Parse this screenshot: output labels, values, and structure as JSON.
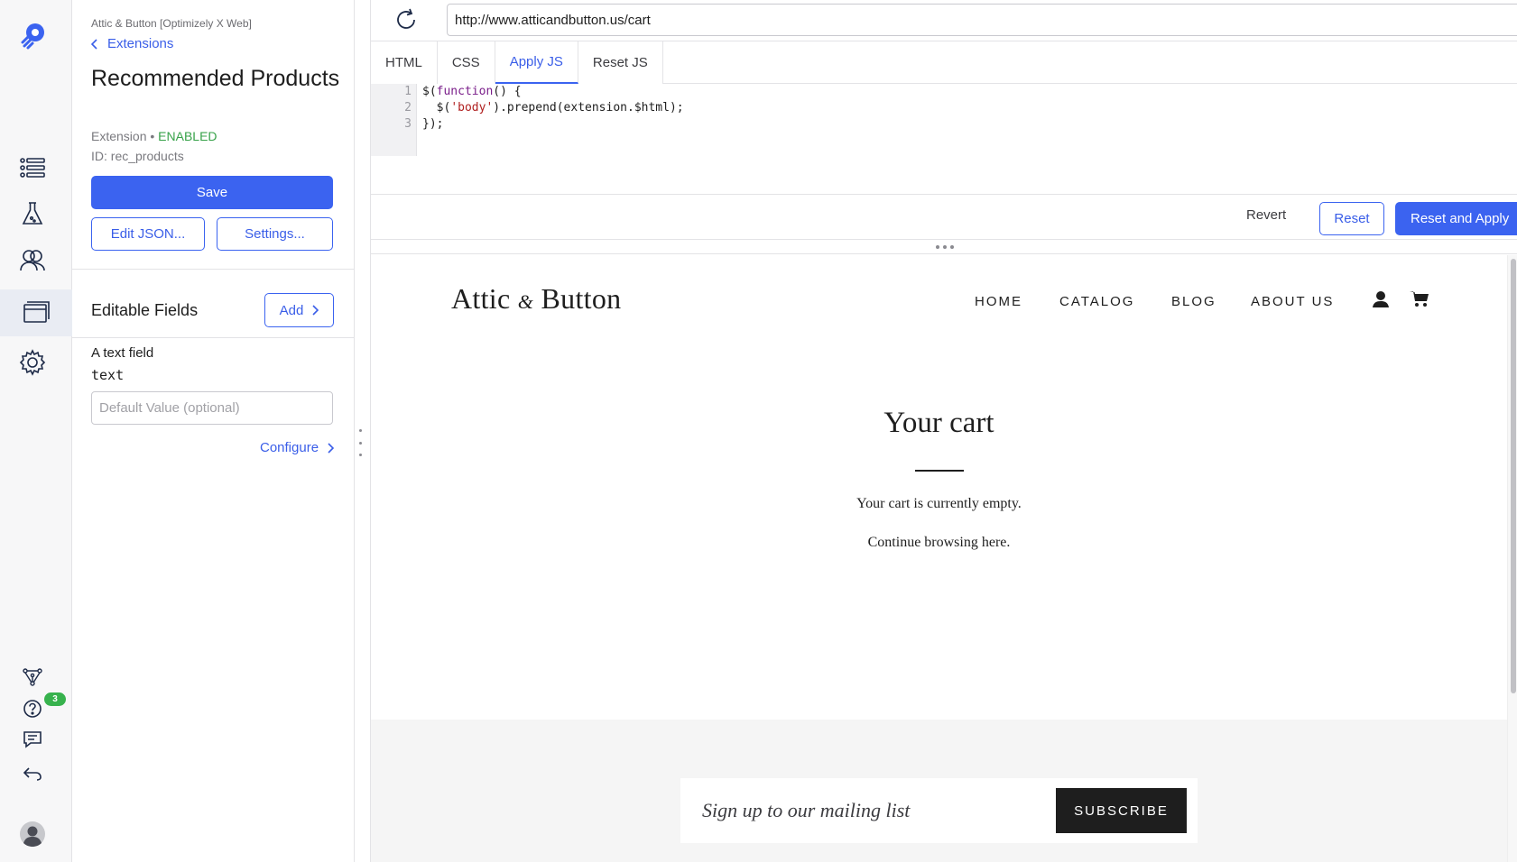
{
  "sidebar": {
    "project_name": "Attic & Button [Optimizely X Web]",
    "back_label": "Extensions",
    "title": "Recommended Products",
    "type_label": "Extension",
    "separator": " • ",
    "status": "ENABLED",
    "id_label": "ID: rec_products",
    "save_label": "Save",
    "edit_json_label": "Edit JSON...",
    "settings_label": "Settings...",
    "editable_fields_title": "Editable Fields",
    "add_label": "Add",
    "field": {
      "label": "A text field",
      "type": "text",
      "placeholder": "Default Value (optional)",
      "configure_label": "Configure"
    }
  },
  "rail": {
    "icons": [
      "logo-icon",
      "list-icon",
      "flask-icon",
      "audiences-icon",
      "extensions-icon",
      "gear-icon",
      "graph-icon",
      "help-icon",
      "chat-icon",
      "return-icon",
      "avatar-icon"
    ],
    "help_badge": "3"
  },
  "editor": {
    "url": "http://www.atticandbutton.us/cart",
    "tabs": [
      "HTML",
      "CSS",
      "Apply JS",
      "Reset JS"
    ],
    "active_tab": "Apply JS",
    "line_numbers": [
      "1",
      "2",
      "3"
    ],
    "code": {
      "line1_a": "$(",
      "line1_kw": "function",
      "line1_b": "() {",
      "line2_a": "  $(",
      "line2_str": "'body'",
      "line2_b": ").prepend(extension.$html);",
      "line3": "});"
    },
    "revert_label": "Revert",
    "reset_label": "Reset",
    "reset_apply_label": "Reset and Apply"
  },
  "site": {
    "logo_a": "Attic",
    "logo_amp": "&",
    "logo_b": "Button",
    "nav": [
      "HOME",
      "CATALOG",
      "BLOG",
      "ABOUT US"
    ],
    "cart_title": "Your cart",
    "cart_empty": "Your cart is currently empty.",
    "continue_text": "Continue browsing here.",
    "newsletter_placeholder": "Sign up to our mailing list",
    "subscribe_label": "SUBSCRIBE"
  },
  "colors": {
    "accent": "#3b63f0",
    "enabled": "#37a249",
    "badge": "#37b24d"
  }
}
